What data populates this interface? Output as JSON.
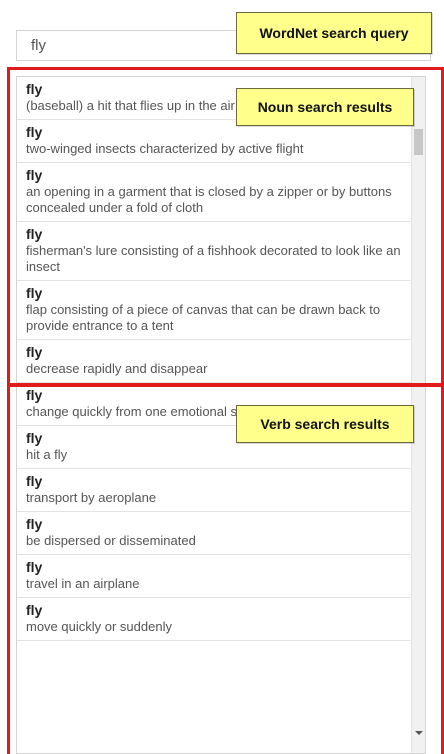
{
  "search": {
    "value": "fly"
  },
  "annotations": {
    "query_label": "WordNet search query",
    "noun_label": "Noun search results",
    "verb_label": "Verb search results"
  },
  "results": [
    {
      "lemma": "fly",
      "gloss": "(baseball) a hit that flies up in the air"
    },
    {
      "lemma": "fly",
      "gloss": "two-winged insects characterized by active flight"
    },
    {
      "lemma": "fly",
      "gloss": "an opening in a garment that is closed by a zipper or by buttons concealed under a fold of cloth"
    },
    {
      "lemma": "fly",
      "gloss": "fisherman's lure consisting of a fishhook decorated to look like an insect"
    },
    {
      "lemma": "fly",
      "gloss": "flap consisting of a piece of canvas that can be drawn back to provide entrance to a tent"
    },
    {
      "lemma": "fly",
      "gloss": "decrease rapidly and disappear"
    },
    {
      "lemma": "fly",
      "gloss": "change quickly from one emotional state to another"
    },
    {
      "lemma": "fly",
      "gloss": "hit a fly"
    },
    {
      "lemma": "fly",
      "gloss": "transport by aeroplane"
    },
    {
      "lemma": "fly",
      "gloss": "be dispersed or disseminated"
    },
    {
      "lemma": "fly",
      "gloss": "travel in an airplane"
    },
    {
      "lemma": "fly",
      "gloss": "move quickly or suddenly"
    }
  ],
  "colors": {
    "highlight": "#e01b1b",
    "callout": "#ffff8c"
  }
}
